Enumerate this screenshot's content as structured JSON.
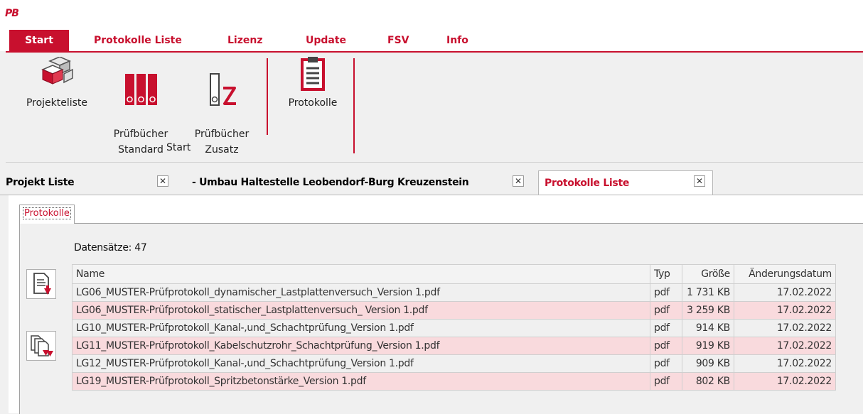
{
  "app": {
    "logo": "PB"
  },
  "menu": {
    "items": [
      {
        "label": "Start",
        "active": true
      },
      {
        "label": "Protokolle Liste"
      },
      {
        "label": "Lizenz"
      },
      {
        "label": "Update"
      },
      {
        "label": "FSV"
      },
      {
        "label": "Info"
      }
    ]
  },
  "ribbon": {
    "group_label": "Start",
    "buttons": [
      {
        "label": "Projekteliste",
        "icon": "cube-stack-icon"
      },
      {
        "label": "Prüfbücher\nStandard",
        "icon": "binders-icon"
      },
      {
        "label": "Prüfbücher\nZusatz",
        "icon": "binder-z-icon"
      },
      {
        "label": "Protokolle",
        "icon": "clipboard-icon"
      }
    ]
  },
  "tabs": [
    {
      "label": "Projekt Liste",
      "close": "✕"
    },
    {
      "label": "- Umbau Haltestelle Leobendorf-Burg Kreuzenstein",
      "close": "✕"
    },
    {
      "label": "Protokolle Liste",
      "close": "✕",
      "active": true
    }
  ],
  "subtab": {
    "label": "Protokolle"
  },
  "list": {
    "count_label": "Datensätze: 47",
    "columns": [
      "Name",
      "Typ",
      "Größe",
      "Änderungsdatum"
    ],
    "rows": [
      [
        "LG06_MUSTER-Prüfprotokoll_dynamischer_Lastplattenversuch_Version 1.pdf",
        "pdf",
        "1 731 KB",
        "17.02.2022"
      ],
      [
        "LG06_MUSTER-Prüfprotokoll_statischer_Lastplattenversuch_ Version 1.pdf",
        "pdf",
        "3 259 KB",
        "17.02.2022"
      ],
      [
        "LG10_MUSTER-Prüfprotokoll_Kanal-,und_Schachtprüfung_Version 1.pdf",
        "pdf",
        "914 KB",
        "17.02.2022"
      ],
      [
        "LG11_MUSTER-Prüfprotokoll_Kabelschutzrohr_Schachtprüfung_Version 1.pdf",
        "pdf",
        "919 KB",
        "17.02.2022"
      ],
      [
        "LG12_MUSTER-Prüfprotokoll_Kanal-,und_Schachtprüfung_Version 1.pdf",
        "pdf",
        "909 KB",
        "17.02.2022"
      ],
      [
        "LG19_MUSTER-Prüfprotokoll_Spritzbetonstärke_Version 1.pdf",
        "pdf",
        "802 KB",
        "17.02.2022"
      ]
    ]
  },
  "side_buttons": [
    {
      "icon": "download-document-icon"
    },
    {
      "icon": "download-documents-icon"
    }
  ],
  "colors": {
    "accent": "#c8102e",
    "alt_row": "#f9dadd"
  }
}
